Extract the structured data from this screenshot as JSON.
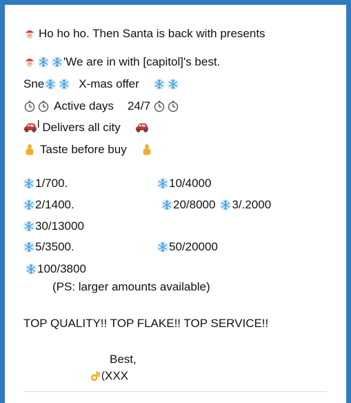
{
  "message": {
    "line1": "Ho ho ho. Then Santa is back with presents",
    "line2": "'We are in with [capitol]'s best.",
    "line3_a": "Sne",
    "line3_b": "X-mas offer",
    "line4_a": "Active days",
    "line4_b": "24/7",
    "line5_a": "l",
    "line5_b": "Delivers all city",
    "line6": "Taste before buy",
    "prices": {
      "p1": "1/700.",
      "p2": "10/4000",
      "p3": "2/1400.",
      "p4": "20/8000",
      "p5": "3/.2000",
      "p6": "30/13000",
      "p7": "5/3500.",
      "p8": "50/20000",
      "p9": "100/3800"
    },
    "ps": "(PS: larger amounts available)",
    "tagline": "TOP QUALITY!! TOP FLAKE!! TOP SERVICE!!",
    "best": "Best,",
    "signoff_mark": "(",
    "signoff": "XXX"
  },
  "icons": {
    "santa": "santa-icon",
    "snowflake": "snowflake-icon",
    "stopwatch": "stopwatch-icon",
    "car": "car-icon",
    "thumb": "thumbs-up-icon",
    "ok_hand": "ok-hand-icon"
  },
  "colors": {
    "frame": "#2f7bc0",
    "snowflake": "#5aa9e6",
    "car": "#d12f2f",
    "thumb": "#f2b233"
  }
}
